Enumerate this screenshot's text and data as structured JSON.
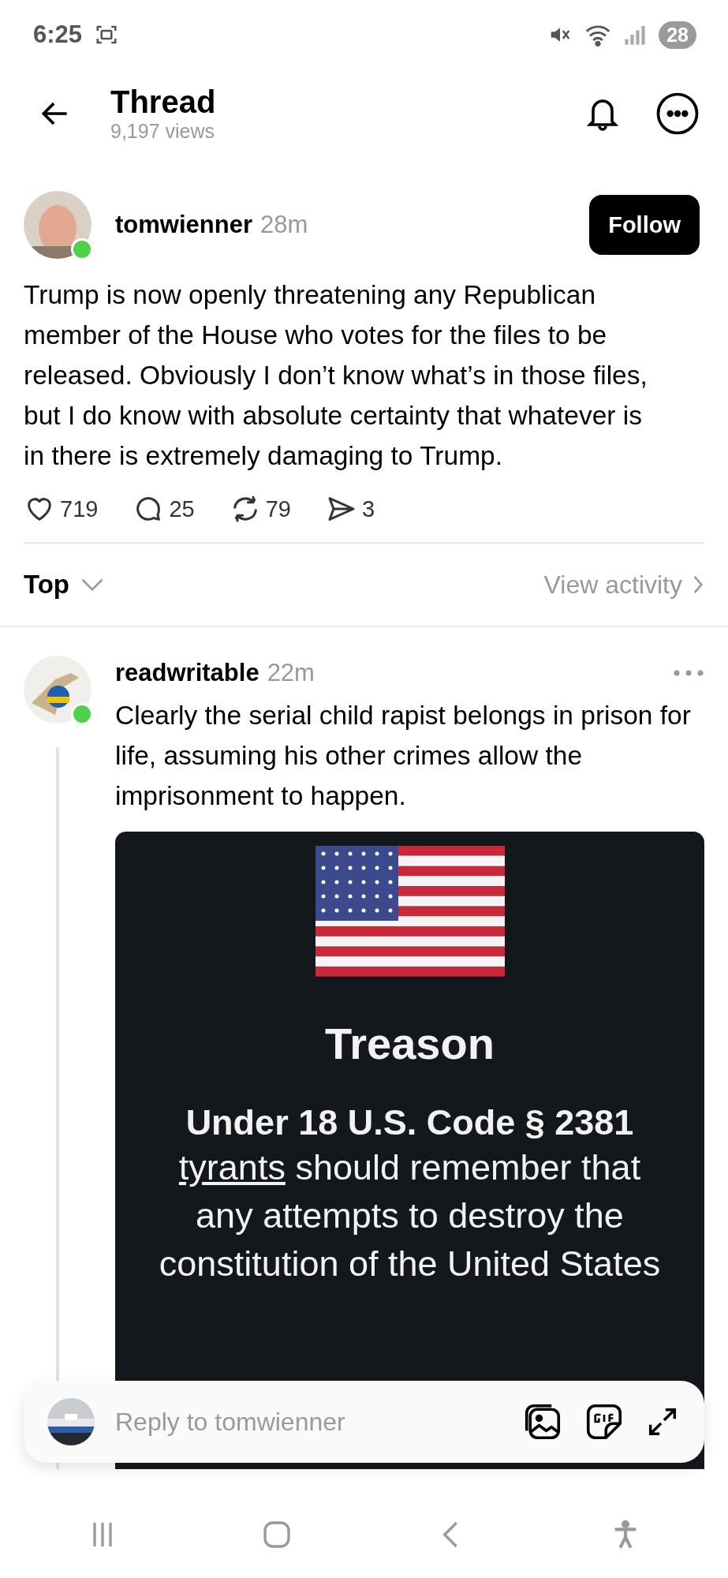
{
  "status_bar": {
    "time": "6:25",
    "battery": "28"
  },
  "header": {
    "title": "Thread",
    "views": "9,197 views"
  },
  "post": {
    "author": "tomwienner",
    "time": "28m",
    "online": true,
    "follow_label": "Follow",
    "text": "Trump is now openly threatening any Republican member of the House who votes for the files to be released.  Obviously I don’t know what’s in those files, but I do know with absolute certainty that whatever is in there is extremely damaging to Trump.",
    "actions": [
      {
        "kind": "like",
        "count": "719"
      },
      {
        "kind": "comment",
        "count": "25"
      },
      {
        "kind": "repost",
        "count": "79"
      },
      {
        "kind": "share",
        "count": "3"
      }
    ]
  },
  "sort": {
    "label": "Top",
    "activity_link": "View activity"
  },
  "replies": [
    {
      "author": "readwritable",
      "time": "22m",
      "online": true,
      "text": "Clearly the serial child rapist belongs in prison for life, assuming his other crimes allow the imprisonment to happen.",
      "image": {
        "heading": "Treason",
        "subheading": "Under 18 U.S. Code § 2381",
        "lines": [
          {
            "underlined": "tyrants",
            "text": "should remember that"
          },
          {
            "text": "any attempts to destroy the"
          },
          {
            "text": "constitution of the United States"
          }
        ]
      }
    }
  ],
  "composer": {
    "placeholder": "Reply to tomwienner"
  }
}
